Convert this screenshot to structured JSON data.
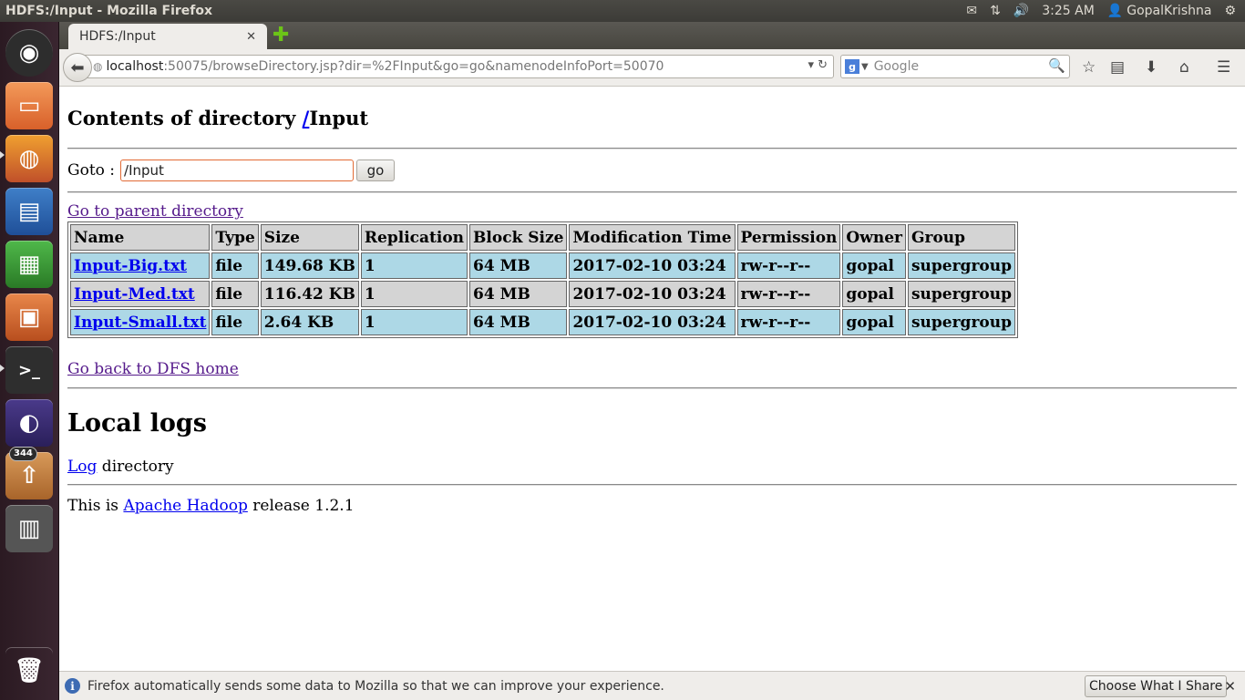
{
  "window": {
    "title": "HDFS:/Input - Mozilla Firefox"
  },
  "panel": {
    "clock": "3:25 AM",
    "user": "GopalKrishna"
  },
  "launcher": {
    "badge_count": "344"
  },
  "tab": {
    "title": "HDFS:/Input"
  },
  "urlbar": {
    "host": "localhost",
    "path": ":50075/browseDirectory.jsp?dir=%2FInput&go=go&namenodeInfoPort=50070"
  },
  "search": {
    "placeholder": "Google"
  },
  "page": {
    "heading_prefix": "Contents of directory ",
    "heading_link": "/",
    "heading_suffix": "Input",
    "goto_label": "Goto :",
    "goto_value": "/Input",
    "goto_button": "go",
    "parent_link": "Go to parent directory",
    "table": {
      "headers": [
        "Name",
        "Type",
        "Size",
        "Replication",
        "Block Size",
        "Modification Time",
        "Permission",
        "Owner",
        "Group"
      ],
      "rows": [
        [
          "Input-Big.txt",
          "file",
          "149.68 KB",
          "1",
          "64 MB",
          "2017-02-10 03:24",
          "rw-r--r--",
          "gopal",
          "supergroup"
        ],
        [
          "Input-Med.txt",
          "file",
          "116.42 KB",
          "1",
          "64 MB",
          "2017-02-10 03:24",
          "rw-r--r--",
          "gopal",
          "supergroup"
        ],
        [
          "Input-Small.txt",
          "file",
          "2.64 KB",
          "1",
          "64 MB",
          "2017-02-10 03:24",
          "rw-r--r--",
          "gopal",
          "supergroup"
        ]
      ]
    },
    "dfs_home_link": "Go back to DFS home",
    "local_logs_heading": "Local logs",
    "log_link": "Log",
    "log_suffix": " directory",
    "release_prefix": "This is ",
    "release_link": "Apache Hadoop",
    "release_suffix": " release 1.2.1"
  },
  "notification": {
    "message": "Firefox automatically sends some data to Mozilla so that we can improve your experience.",
    "button": "Choose What I Share"
  }
}
